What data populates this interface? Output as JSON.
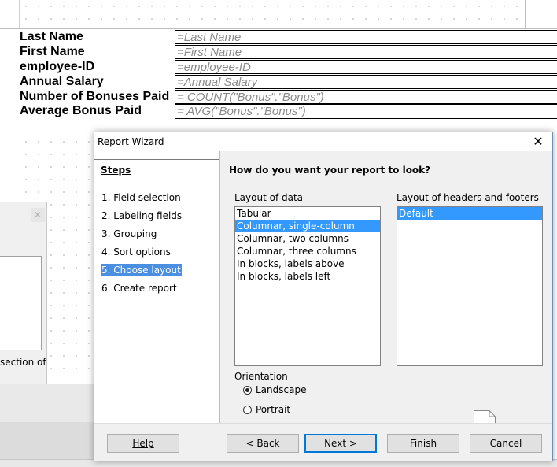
{
  "report_fields": [
    {
      "label": "Last Name",
      "value": "=Last Name"
    },
    {
      "label": "First Name",
      "value": "=First Name"
    },
    {
      "label": "employee-ID",
      "value": "=employee-ID"
    },
    {
      "label": "Annual Salary",
      "value": "=Annual Salary"
    },
    {
      "label": "Number of Bonuses Paid",
      "value": "= COUNT(\"Bonus\".\"Bonus\")"
    },
    {
      "label": "Average Bonus Paid",
      "value": "= AVG(\"Bonus\".\"Bonus\")"
    }
  ],
  "background_dialog": {
    "text": "section of"
  },
  "wizard": {
    "title": "Report Wizard",
    "steps_title": "Steps",
    "steps": [
      {
        "label": "1. Field selection"
      },
      {
        "label": "2. Labeling fields"
      },
      {
        "label": "3. Grouping"
      },
      {
        "label": "4. Sort options"
      },
      {
        "label": "5. Choose layout",
        "active": true
      },
      {
        "label": "6. Create report"
      }
    ],
    "question": "How do you want your report to look?",
    "layout_of_data": {
      "label": "Layout of data",
      "items": [
        "Tabular",
        "Columnar, single-column",
        "Columnar, two columns",
        "Columnar, three columns",
        "In blocks, labels above",
        "In blocks, labels left"
      ],
      "selected": "Columnar, single-column"
    },
    "headers_footers": {
      "label": "Layout of headers and footers",
      "items": [
        "Default"
      ],
      "selected": "Default"
    },
    "orientation": {
      "label": "Orientation",
      "options": [
        "Landscape",
        "Portrait"
      ],
      "selected": "Landscape"
    },
    "buttons": {
      "help": "Help",
      "back": "< Back",
      "next": "Next >",
      "finish": "Finish",
      "cancel": "Cancel"
    }
  }
}
